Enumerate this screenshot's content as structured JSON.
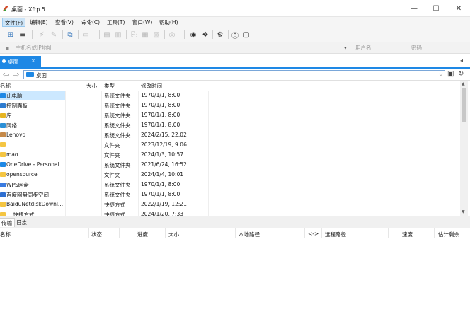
{
  "window": {
    "title": "桌面 - Xftp 5",
    "controls": {
      "minimize": "—",
      "maximize": "☐",
      "close": "✕"
    }
  },
  "menu": [
    {
      "label": "文件(F)",
      "active": true
    },
    {
      "label": "编辑(E)"
    },
    {
      "label": "查看(V)"
    },
    {
      "label": "命令(C)"
    },
    {
      "label": "工具(T)"
    },
    {
      "label": "窗口(W)"
    },
    {
      "label": "帮助(H)"
    }
  ],
  "address": {
    "host_placeholder": "主机名或IP地址",
    "user_placeholder": "用户名",
    "password_placeholder": "密码"
  },
  "tab": {
    "label": "桌面",
    "close": "×"
  },
  "path": {
    "value": "桌面"
  },
  "files": {
    "columns": {
      "name": "名称",
      "size": "大小",
      "type": "类型",
      "modified": "修改时间"
    },
    "rows": [
      {
        "name": "此电脑",
        "type": "系统文件夹",
        "modified": "1970/1/1, 8:00",
        "icon": "computer-icon",
        "color": "#1e88e5",
        "selected": true
      },
      {
        "name": "控制面板",
        "type": "系统文件夹",
        "modified": "1970/1/1, 8:00",
        "icon": "control-panel-icon",
        "color": "#2e7bcf"
      },
      {
        "name": "库",
        "type": "系统文件夹",
        "modified": "1970/1/1, 8:00",
        "icon": "library-icon",
        "color": "#e6b422"
      },
      {
        "name": "网络",
        "type": "系统文件夹",
        "modified": "1970/1/1, 8:00",
        "icon": "network-icon",
        "color": "#2b8fd6"
      },
      {
        "name": "Lenovo",
        "type": "系统文件夹",
        "modified": "2024/2/15, 22:02",
        "icon": "user-icon",
        "color": "#c58a4a"
      },
      {
        "name": "",
        "type": "文件夹",
        "modified": "2023/12/19, 9:06",
        "icon": "folder-icon",
        "color": "#f4c542"
      },
      {
        "name": "mao",
        "type": "文件夹",
        "modified": "2024/1/3, 10:57",
        "icon": "folder-icon",
        "color": "#f4c542"
      },
      {
        "name": "OneDrive - Personal",
        "type": "系统文件夹",
        "modified": "2021/6/24, 16:52",
        "icon": "cloud-icon",
        "color": "#1e88e5"
      },
      {
        "name": "opensource",
        "type": "文件夹",
        "modified": "2024/1/4, 10:01",
        "icon": "folder-icon",
        "color": "#f4c542"
      },
      {
        "name": "WPS网盘",
        "type": "系统文件夹",
        "modified": "1970/1/1, 8:00",
        "icon": "cloud-icon",
        "color": "#3a7be0"
      },
      {
        "name": "百度网盘同步空间",
        "type": "系统文件夹",
        "modified": "1970/1/1, 8:00",
        "icon": "sync-icon",
        "color": "#2f6fd0"
      },
      {
        "name": "BaiduNetdiskDownl...",
        "type": "快捷方式",
        "modified": "2022/1/19, 12:21",
        "icon": "shortcut-icon",
        "color": "#f4c542"
      },
      {
        "name": "...  快捷方式",
        "type": "快捷方式",
        "modified": "2024/1/20, 7:33",
        "icon": "shortcut-icon",
        "color": "#f4c542"
      }
    ]
  },
  "lower_tabs": [
    {
      "label": "传输",
      "active": true
    },
    {
      "label": "日志"
    }
  ],
  "transfer": {
    "columns": {
      "name": "名称",
      "status": "状态",
      "progress": "进度",
      "size": "大小",
      "local": "本地路径",
      "direction": "<->",
      "remote": "远程路径",
      "speed": "速度",
      "remaining": "估计剩余..."
    }
  }
}
